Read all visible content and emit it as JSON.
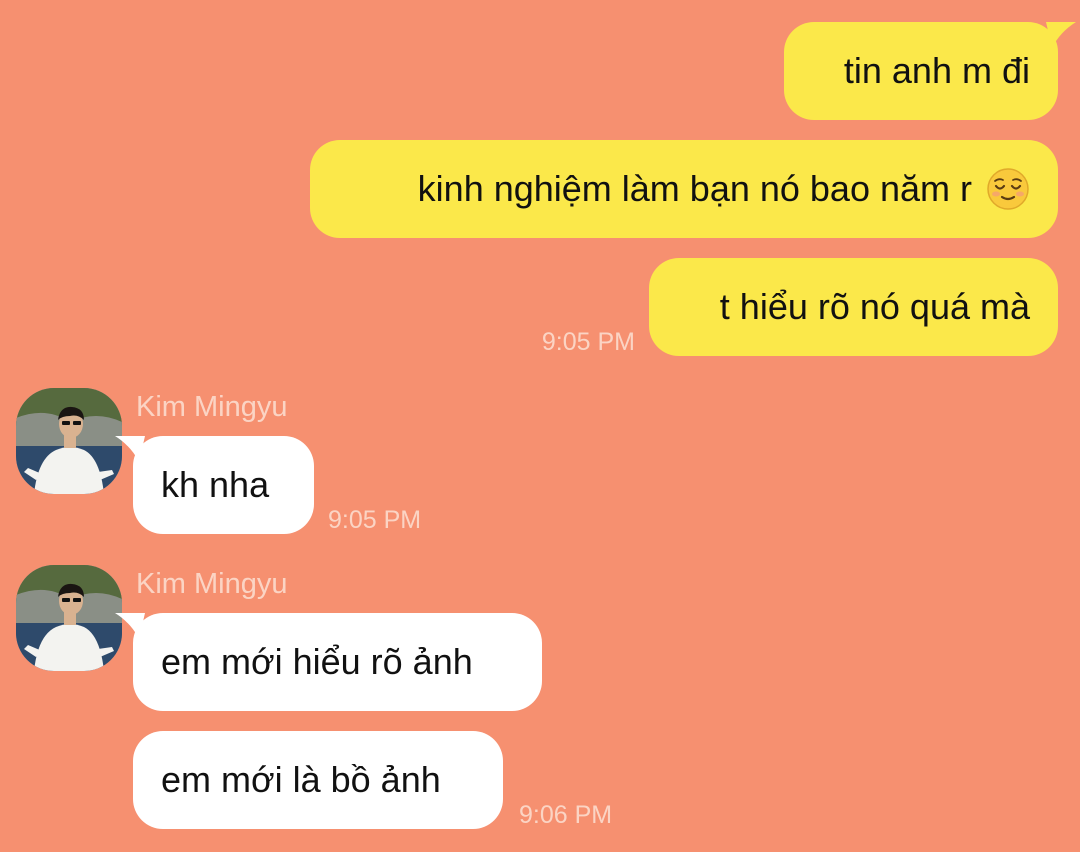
{
  "theme": {
    "background": "#f69070",
    "outgoing_bubble": "#fbe84a",
    "incoming_bubble": "#ffffff",
    "timestamp_color": "#fbd4c4",
    "sender_name_color": "#fbd4c4"
  },
  "outgoing": [
    {
      "text": "tin anh m đi"
    },
    {
      "text": "kinh nghiệm làm bạn nó bao năm r",
      "emoji": "relieved-face-emoji"
    },
    {
      "text": "t hiểu rõ nó quá mà",
      "time": "9:05 PM"
    }
  ],
  "incoming_groups": [
    {
      "sender": "Kim Mingyu",
      "avatar": "profile-photo",
      "messages": [
        {
          "text": "kh nha",
          "time": "9:05 PM"
        }
      ]
    },
    {
      "sender": "Kim Mingyu",
      "avatar": "profile-photo",
      "messages": [
        {
          "text": "em mới hiểu rõ ảnh"
        },
        {
          "text": "em mới là bồ ảnh",
          "time": "9:06 PM"
        }
      ]
    }
  ]
}
